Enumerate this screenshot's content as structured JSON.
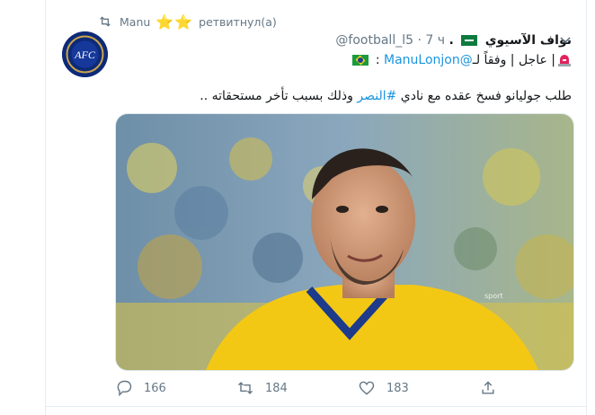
{
  "retweet": {
    "retweeter": "Manu",
    "stars": "⭐⭐",
    "label": "ретвитнул(а)"
  },
  "tweet": {
    "display_name": "نواف الآسيوي",
    "trailing_dot": ".",
    "handle": "@football_l5",
    "separator": "·",
    "time": "7 ч",
    "line1_prefix": "| عاجل | وفقاً لـ",
    "mention": "@ManuLonjon",
    "line1_suffix": " :",
    "line2_before": "طلب جوليانو فسخ عقده مع نادي ",
    "hashtag": "#النصر",
    "line2_after": " وذلك بسبب تأخر مستحقاته .."
  },
  "avatar": {
    "text": "AFC"
  },
  "actions": {
    "replies": "166",
    "retweets": "184",
    "likes": "183"
  },
  "icons": [
    "retweet-icon",
    "star-icon",
    "saudi-flag-icon",
    "caret-down-icon",
    "brazil-flag-icon",
    "siren-icon",
    "reply-icon",
    "retweet-icon",
    "like-icon",
    "share-icon"
  ],
  "colors": {
    "link": "#1b95e0",
    "muted": "#657786",
    "text": "#14171a",
    "avatar_bg": "#0d2a79",
    "jersey": "#f3c815"
  }
}
